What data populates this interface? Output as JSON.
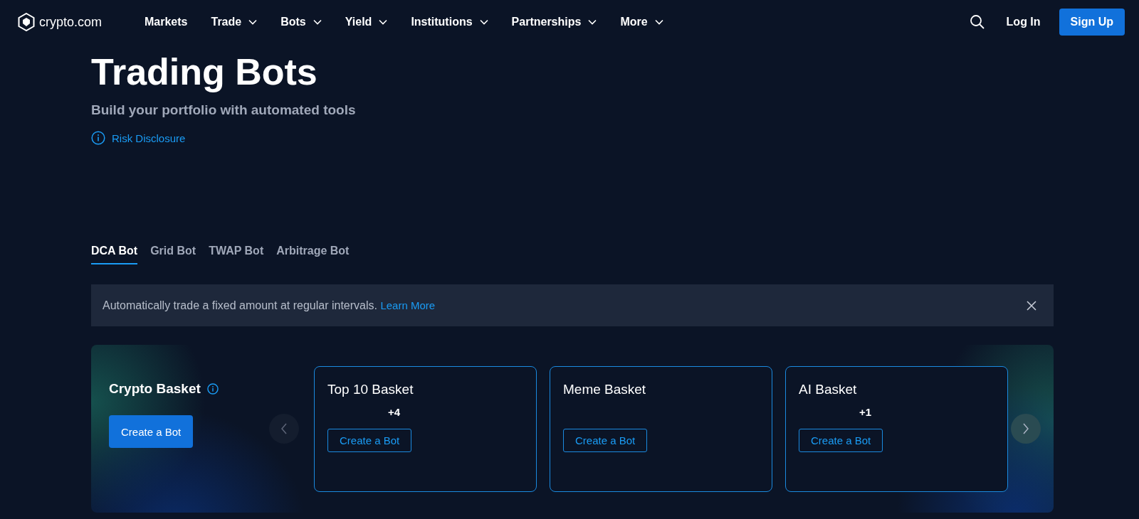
{
  "nav": {
    "logo": "crypto.com",
    "items": [
      {
        "label": "Markets",
        "has_dropdown": false
      },
      {
        "label": "Trade",
        "has_dropdown": true
      },
      {
        "label": "Bots",
        "has_dropdown": true
      },
      {
        "label": "Yield",
        "has_dropdown": true
      },
      {
        "label": "Institutions",
        "has_dropdown": true
      },
      {
        "label": "Partnerships",
        "has_dropdown": true
      },
      {
        "label": "More",
        "has_dropdown": true
      }
    ],
    "login": "Log In",
    "signup": "Sign Up"
  },
  "hero": {
    "title": "Trading Bots",
    "subtitle": "Build your portfolio with automated tools",
    "risk_link": "Risk Disclosure"
  },
  "tabs": [
    {
      "label": "DCA Bot",
      "selected": true
    },
    {
      "label": "Grid Bot",
      "selected": false
    },
    {
      "label": "TWAP Bot",
      "selected": false
    },
    {
      "label": "Arbitrage Bot",
      "selected": false
    }
  ],
  "banner": {
    "text": "Automatically trade a fixed amount at regular intervals.",
    "link": "Learn More"
  },
  "basket_section": {
    "title": "Crypto Basket",
    "button": "Create a Bot",
    "cards": [
      {
        "title": "Top 10 Basket",
        "extra": "+4",
        "button": "Create a Bot"
      },
      {
        "title": "Meme Basket",
        "button": "Create a Bot"
      },
      {
        "title": "AI Basket",
        "extra": "+1",
        "button": "Create a Bot"
      }
    ]
  }
}
